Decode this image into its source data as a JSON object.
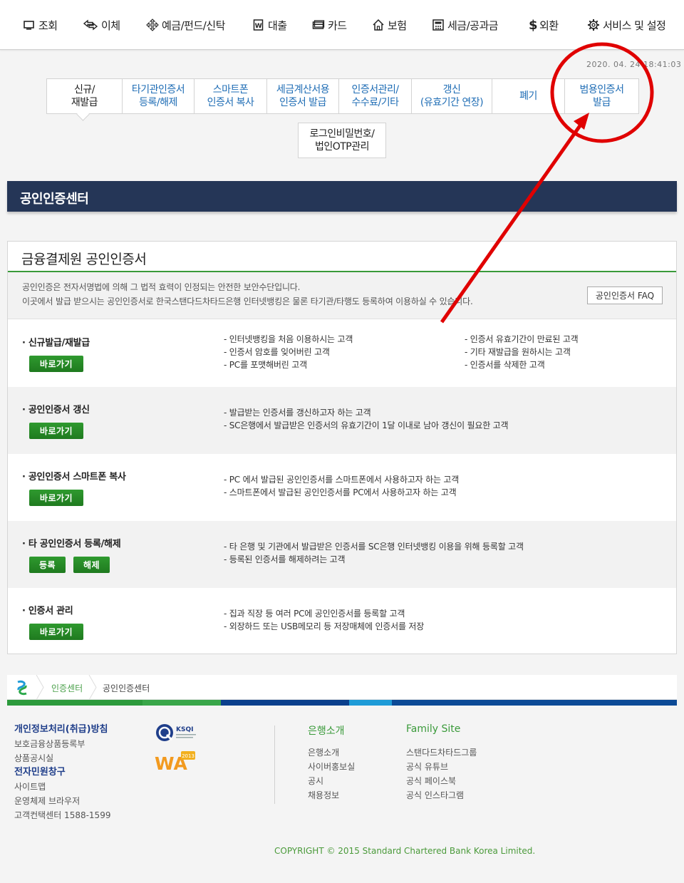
{
  "topnav": {
    "items": [
      {
        "label": "조회",
        "icon": "monitor-icon"
      },
      {
        "label": "이체",
        "icon": "transfer-arrows-icon"
      },
      {
        "label": "예금/펀드/신탁",
        "icon": "four-way-arrows-icon"
      },
      {
        "label": "대출",
        "icon": "won-document-icon"
      },
      {
        "label": "카드",
        "icon": "card-icon"
      },
      {
        "label": "보험",
        "icon": "house-icon"
      },
      {
        "label": "세금/공과금",
        "icon": "calculator-icon"
      },
      {
        "label": "외환",
        "icon": "dollar-icon"
      },
      {
        "label": "서비스 및 설정",
        "icon": "gear-icon"
      }
    ]
  },
  "timestamp": "2020. 04. 24  18:41:03",
  "tabs": [
    {
      "label": "신규/\n재발급",
      "active": true
    },
    {
      "label": "타기관인증서\n등록/해제",
      "active": false
    },
    {
      "label": "스마트폰\n인증서 복사",
      "active": false
    },
    {
      "label": "세금계산서용\n인증서 발급",
      "active": false
    },
    {
      "label": "인증서관리/\n수수료/기타",
      "active": false
    },
    {
      "label": "갱신\n(유효기간 연장)",
      "active": false
    },
    {
      "label": "폐기",
      "active": false
    },
    {
      "label": "범용인증서\n발급",
      "active": false
    }
  ],
  "tab_row2": {
    "label": "로그인비밀번호/\n법인OTP관리"
  },
  "page_title": "공인인증센터",
  "panel": {
    "title": "금융결제원 공인인증서",
    "intro_line1": "공인인증은 전자서명법에 의해 그 법적 효력이 인정되는 안전한 보안수단입니다.",
    "intro_line2": "이곳에서 발급 받으시는 공인인증서로 한국스탠다드차타드은행 인터넷뱅킹은 물론 타기관/타행도 등록하여 이용하실 수 있습니다.",
    "faq_button": "공인인증서 FAQ",
    "rows": [
      {
        "title": "신규발급/재발급",
        "buttons": [
          "바로가기"
        ],
        "desc_left": [
          "- 인터넷뱅킹을 처음 이용하시는 고객",
          "- 인증서 암호를 잊어버린 고객",
          "- PC를 포맷해버린 고객"
        ],
        "desc_right": [
          "- 인증서 유효기간이 만료된 고객",
          "- 기타 재발급을 원하시는 고객",
          "- 인증서를 삭제한 고객"
        ]
      },
      {
        "title": "공인인증서 갱신",
        "buttons": [
          "바로가기"
        ],
        "desc_left": [
          "- 발급받는 인증서를 갱신하고자 하는 고객",
          "- SC은행에서 발급받은 인증서의 유효기간이 1달 이내로 남아 갱신이 필요한 고객"
        ]
      },
      {
        "title": "공인인증서 스마트폰 복사",
        "buttons": [
          "바로가기"
        ],
        "desc_left": [
          "- PC 에서 발급된 공인인증서를 스마트폰에서 사용하고자 하는 고객",
          "- 스마트폰에서 발급된 공인인증서를 PC에서 사용하고자 하는 고객"
        ]
      },
      {
        "title": "타 공인인증서 등록/해제",
        "buttons": [
          "등록",
          "해제"
        ],
        "desc_left": [
          "- 타 은행 및 기관에서 발급받은 인증서를 SC은행 인터넷뱅킹 이용을 위해 등록할 고객",
          "- 등록된 인증서를 해제하려는 고객"
        ]
      },
      {
        "title": "인증서 관리",
        "buttons": [
          "바로가기"
        ],
        "desc_left": [
          "- 집과 직장 등 여러 PC에 공인인증서를 등록할 고객",
          "- 외장하드 또는 USB메모리 등 저장매체에 인증서를 저장"
        ]
      }
    ]
  },
  "breadcrumb": {
    "level1": "인증센터",
    "level2": "공인인증센터"
  },
  "footer": {
    "col1": [
      {
        "label": "개인정보처리(취급)방침",
        "bold": true
      },
      {
        "label": "보호금융상품등록부",
        "bold": false
      },
      {
        "label": "상품공시실",
        "bold": false
      },
      {
        "label": "전자민원창구",
        "bold": true
      },
      {
        "label": "사이트맵",
        "bold": false
      },
      {
        "label": "운영체제 브라우저",
        "bold": false
      },
      {
        "label": "고객컨택센터 1588-1599",
        "bold": false
      }
    ],
    "bank_heading": "은행소개",
    "bank_links": [
      "은행소개",
      "사이버홍보실",
      "공시",
      "채용정보"
    ],
    "family_heading": "Family Site",
    "family_links": [
      "스탠다드차타드그룹",
      "공식 유튜브",
      "공식 페이스북",
      "공식 인스타그램"
    ],
    "ksqi_label": "KSQI",
    "wa_label": "WA",
    "wa_year": "2013",
    "copyright": "COPYRIGHT © 2015 Standard Chartered Bank Korea Limited."
  },
  "colors": {
    "accent_green": "#1f7a1f",
    "header_navy": "#253657",
    "link_blue": "#1f6db5",
    "annotation_red": "#e00000"
  }
}
